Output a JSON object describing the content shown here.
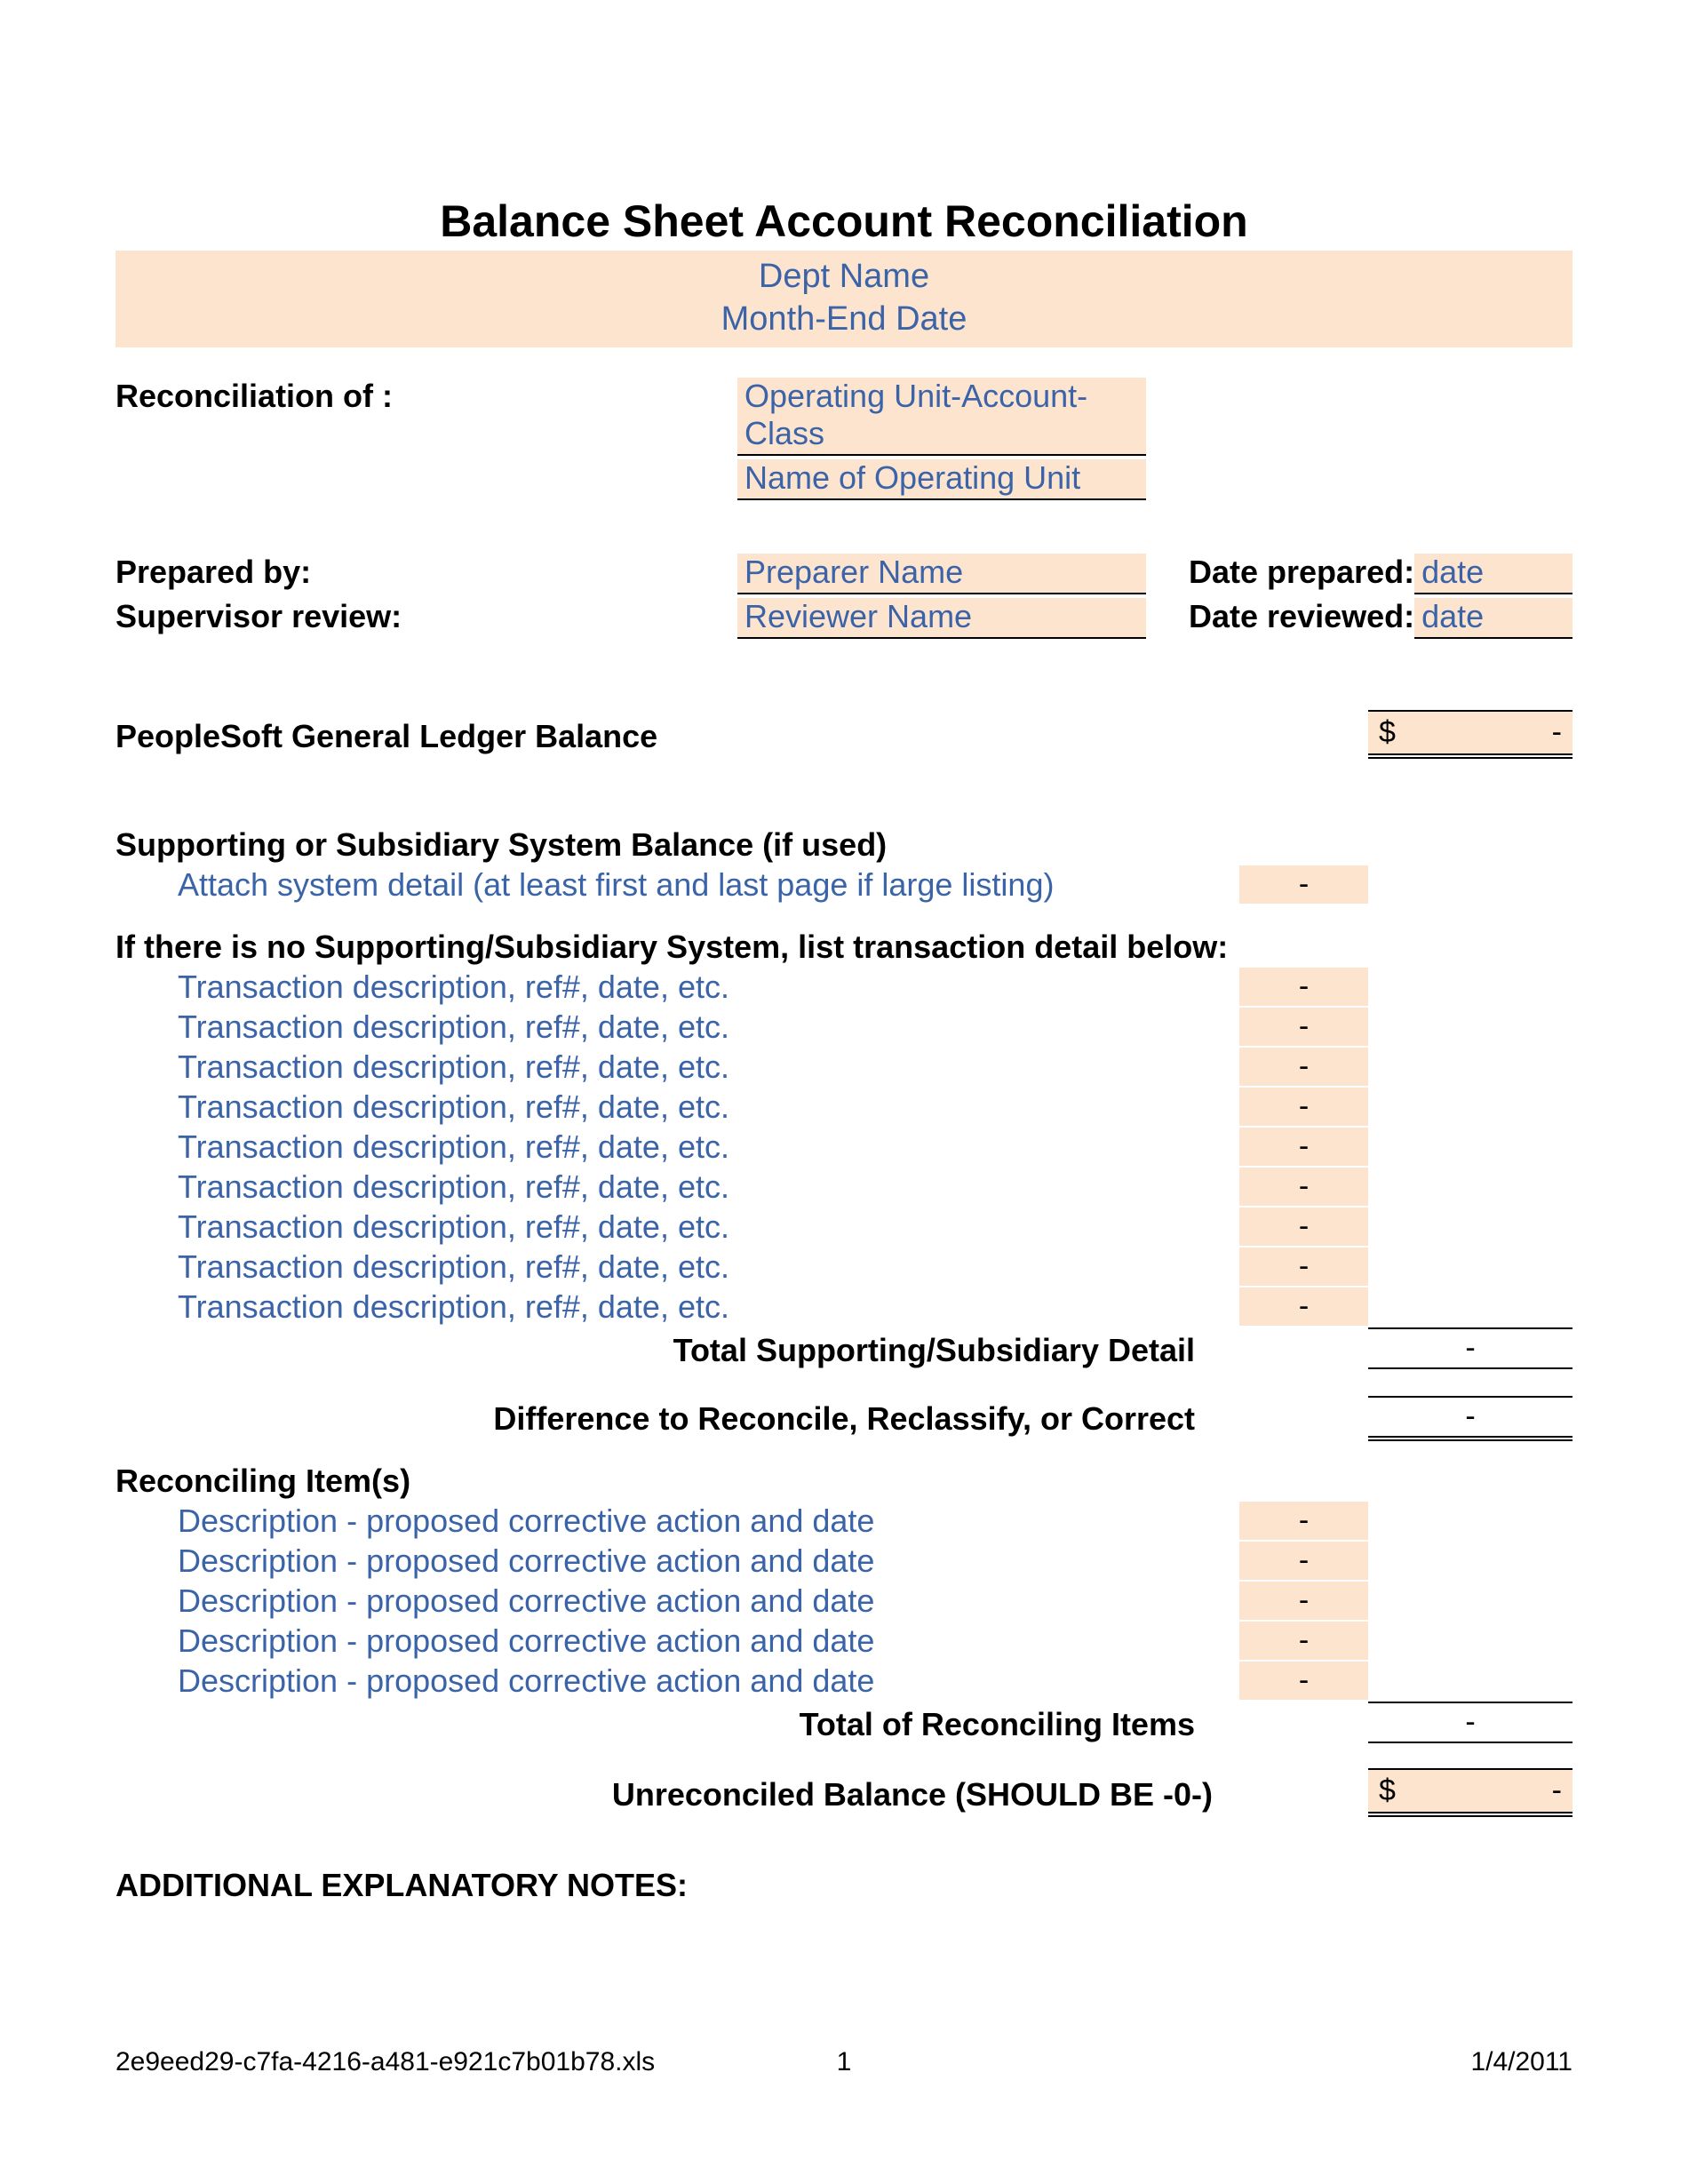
{
  "title": "Balance Sheet Account Reconciliation",
  "header": {
    "dept": "Dept Name",
    "date": "Month-End Date"
  },
  "reconciliation": {
    "label": "Reconciliation of :",
    "value1": "Operating Unit-Account-Class",
    "value2": "Name of Operating Unit"
  },
  "prepared": {
    "by_label": "Prepared by:",
    "by_value": "Preparer Name",
    "date_label": "Date prepared:",
    "date_value": "date"
  },
  "supervisor": {
    "label": "Supervisor review:",
    "value": "Reviewer Name",
    "date_label": "Date reviewed:",
    "date_value": "date"
  },
  "gl_balance": {
    "label": "PeopleSoft General Ledger Balance",
    "currency": "$",
    "value": "-"
  },
  "supporting": {
    "heading": "Supporting or Subsidiary System Balance (if used)",
    "attach": "Attach system detail (at least first and last page if large listing)",
    "attach_value": "-"
  },
  "no_supporting_heading": "If there is no Supporting/Subsidiary System, list transaction detail below:",
  "transactions": [
    {
      "desc": "Transaction description, ref#, date, etc.",
      "val": "-"
    },
    {
      "desc": "Transaction description, ref#, date, etc.",
      "val": "-"
    },
    {
      "desc": "Transaction description, ref#, date, etc.",
      "val": "-"
    },
    {
      "desc": "Transaction description, ref#, date, etc.",
      "val": "-"
    },
    {
      "desc": "Transaction description, ref#, date, etc.",
      "val": "-"
    },
    {
      "desc": "Transaction description, ref#, date, etc.",
      "val": "-"
    },
    {
      "desc": "Transaction description, ref#, date, etc.",
      "val": "-"
    },
    {
      "desc": "Transaction description, ref#, date, etc.",
      "val": "-"
    },
    {
      "desc": "Transaction description, ref#, date, etc.",
      "val": "-"
    }
  ],
  "total_supporting": {
    "label": "Total Supporting/Subsidiary Detail",
    "value": "-"
  },
  "difference": {
    "label": "Difference to Reconcile, Reclassify, or Correct",
    "value": "-"
  },
  "reconciling_heading": "Reconciling Item(s)",
  "reconciling_items": [
    {
      "desc": "Description - proposed corrective action and date",
      "val": "-"
    },
    {
      "desc": "Description - proposed corrective action and date",
      "val": "-"
    },
    {
      "desc": "Description - proposed corrective action and date",
      "val": "-"
    },
    {
      "desc": "Description - proposed corrective action and date",
      "val": "-"
    },
    {
      "desc": "Description - proposed corrective action and date",
      "val": "-"
    }
  ],
  "total_reconciling": {
    "label": "Total of Reconciling Items",
    "value": "-"
  },
  "unreconciled": {
    "label": "Unreconciled Balance (SHOULD BE -0-)",
    "currency": "$",
    "value": "-"
  },
  "notes_heading": "ADDITIONAL EXPLANATORY NOTES:",
  "footer": {
    "file": "2e9eed29-c7fa-4216-a481-e921c7b01b78.xls",
    "page": "1",
    "date": "1/4/2011"
  }
}
